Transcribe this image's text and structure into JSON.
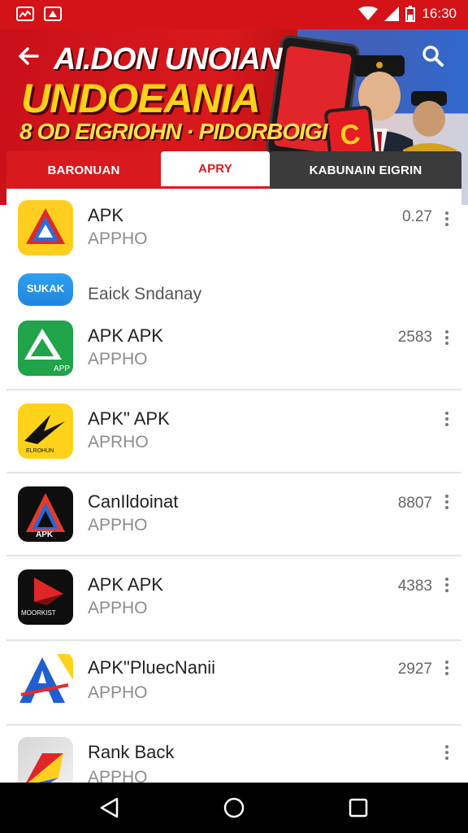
{
  "status_bar": {
    "time": "16:30",
    "left_icons": [
      "photo-notification-icon",
      "app-notification-icon"
    ],
    "right_icons": [
      "wifi-icon",
      "cell-signal-icon",
      "battery-icon"
    ]
  },
  "header": {
    "title_line1": "AI.DON UNOIAN",
    "title_line2": "UNDOEANIA",
    "title_line3": "8 OD EIGRIOHN · PIDORBOIGI",
    "phone_badge": "C"
  },
  "tabs": [
    {
      "label": "BARONUAN",
      "active": false
    },
    {
      "label": "APRY",
      "active": true
    },
    {
      "label": "KABUNAIN EIGRIN",
      "active": false
    }
  ],
  "section": {
    "label": "Eaick Sndanay",
    "icon_text": "SUKAK"
  },
  "apps": [
    {
      "name": "APK",
      "sub": "APPHO",
      "meta": "0.27",
      "icon": "yellow-triangle-icon"
    },
    {
      "name": "APK APK",
      "sub": "APPHO",
      "meta": "2583",
      "icon": "green-apk-icon",
      "icon_text": "APP"
    },
    {
      "name": "APK\" APK",
      "sub": "APRHO",
      "meta": "",
      "icon": "yellow-arrow-icon",
      "icon_text": "ELROHUN"
    },
    {
      "name": "CanIldoinat",
      "sub": "APPHO",
      "meta": "8807",
      "icon": "black-triangle-icon",
      "icon_text": "APK"
    },
    {
      "name": "APK APK",
      "sub": "APPHO",
      "meta": "4383",
      "icon": "red-play-icon",
      "icon_text": "MOORKIST"
    },
    {
      "name": "APK\"PluecNanii",
      "sub": "APPHO",
      "meta": "2927",
      "icon": "blue-a-icon"
    },
    {
      "name": "Rank Back",
      "sub": "APPHO",
      "meta": "",
      "icon": "colorful-arrow-icon"
    }
  ],
  "colors": {
    "brand_red": "#d31317",
    "accent_yellow": "#ffd21a",
    "tab_dark": "#3b3b3b"
  },
  "nav": {
    "buttons": [
      "back-triangle-icon",
      "home-circle-icon",
      "recents-square-icon"
    ]
  }
}
